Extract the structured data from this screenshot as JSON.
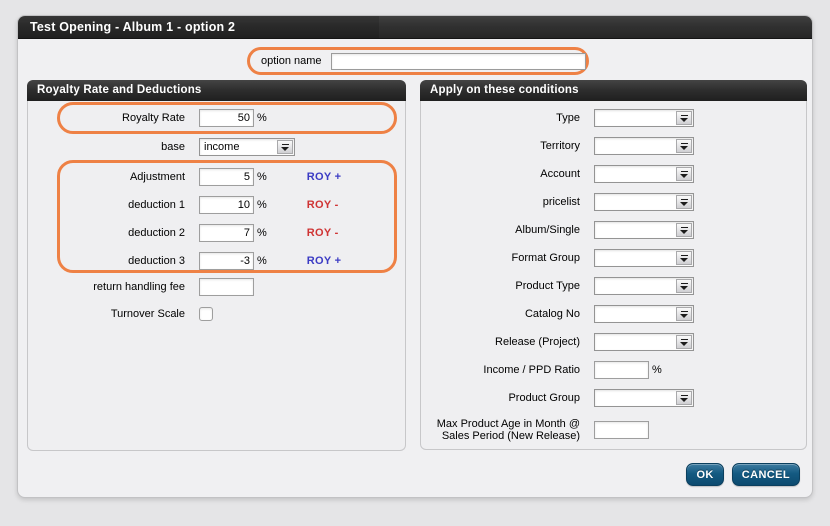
{
  "window": {
    "title": "Test Opening - Album 1 - option 2"
  },
  "option_name": {
    "label": "option name",
    "value": ""
  },
  "left_panel": {
    "title": "Royalty Rate and Deductions",
    "royalty_rate": {
      "label": "Royalty Rate",
      "value": "50",
      "suffix": "%"
    },
    "base": {
      "label": "base",
      "value": "income"
    },
    "adjustments": [
      {
        "label": "Adjustment",
        "value": "5",
        "suffix": "%",
        "roy": "ROY +",
        "tone": "plus"
      },
      {
        "label": "deduction 1",
        "value": "10",
        "suffix": "%",
        "roy": "ROY -",
        "tone": "minus"
      },
      {
        "label": "deduction 2",
        "value": "7",
        "suffix": "%",
        "roy": "ROY -",
        "tone": "minus"
      },
      {
        "label": "deduction 3",
        "value": "-3",
        "suffix": "%",
        "roy": "ROY +",
        "tone": "plus"
      }
    ],
    "return_handling_fee": {
      "label": "return handling fee",
      "value": ""
    },
    "turnover_scale": {
      "label": "Turnover Scale",
      "checked": false
    }
  },
  "right_panel": {
    "title": "Apply on these conditions",
    "conditions": [
      {
        "label": "Type",
        "value": ""
      },
      {
        "label": "Territory",
        "value": ""
      },
      {
        "label": "Account",
        "value": ""
      },
      {
        "label": "pricelist",
        "value": ""
      },
      {
        "label": "Album/Single",
        "value": ""
      },
      {
        "label": "Format Group",
        "value": ""
      },
      {
        "label": "Product Type",
        "value": ""
      },
      {
        "label": "Catalog No",
        "value": ""
      },
      {
        "label": "Release (Project)",
        "value": ""
      }
    ],
    "income_ppd_ratio": {
      "label": "Income / PPD Ratio",
      "value": "",
      "suffix": "%"
    },
    "product_group": {
      "label": "Product Group",
      "value": ""
    },
    "max_product_age": {
      "label_line1": "Max Product Age in Month @",
      "label_line2": "Sales Period (New Release)",
      "value": ""
    }
  },
  "buttons": {
    "ok": "OK",
    "cancel": "CANCEL"
  },
  "colors": {
    "highlight_orange": "#ee8145",
    "roy_plus_blue": "#3b3bc4",
    "roy_minus_red": "#cf3434",
    "button_blue": "#145a82",
    "titlebar_dark": "#2d2d2d"
  }
}
